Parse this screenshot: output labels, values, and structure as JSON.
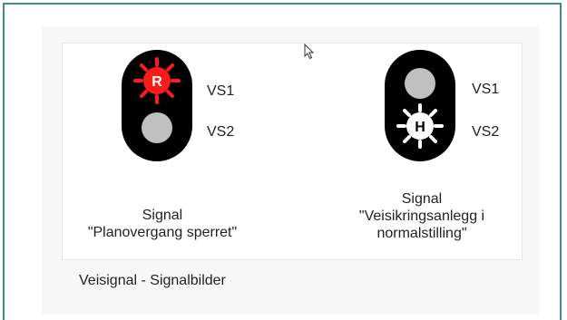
{
  "figure": {
    "left_signal": {
      "lamp_top_letter": "R",
      "lamp_labels": [
        "VS1",
        "VS2"
      ],
      "caption_line1": "Signal",
      "caption_line2": "\"Planovergang sperret\"",
      "lit_color": "#ff1a1a"
    },
    "right_signal": {
      "lamp_bottom_letter": "H",
      "lamp_labels": [
        "VS1",
        "VS2"
      ],
      "caption_line1": "Signal",
      "caption_line2": "\"Veisikringsanlegg i",
      "caption_line3": "normalstilling\"",
      "lit_color": "#ffffff"
    },
    "caption": "Veisignal - Signalbilder"
  },
  "colors": {
    "frame_border": "#3b8d8f",
    "signal_body": "#000000",
    "unlit_lamp": "#c0c0c0"
  },
  "cursor_icon": "mouse-pointer-icon"
}
